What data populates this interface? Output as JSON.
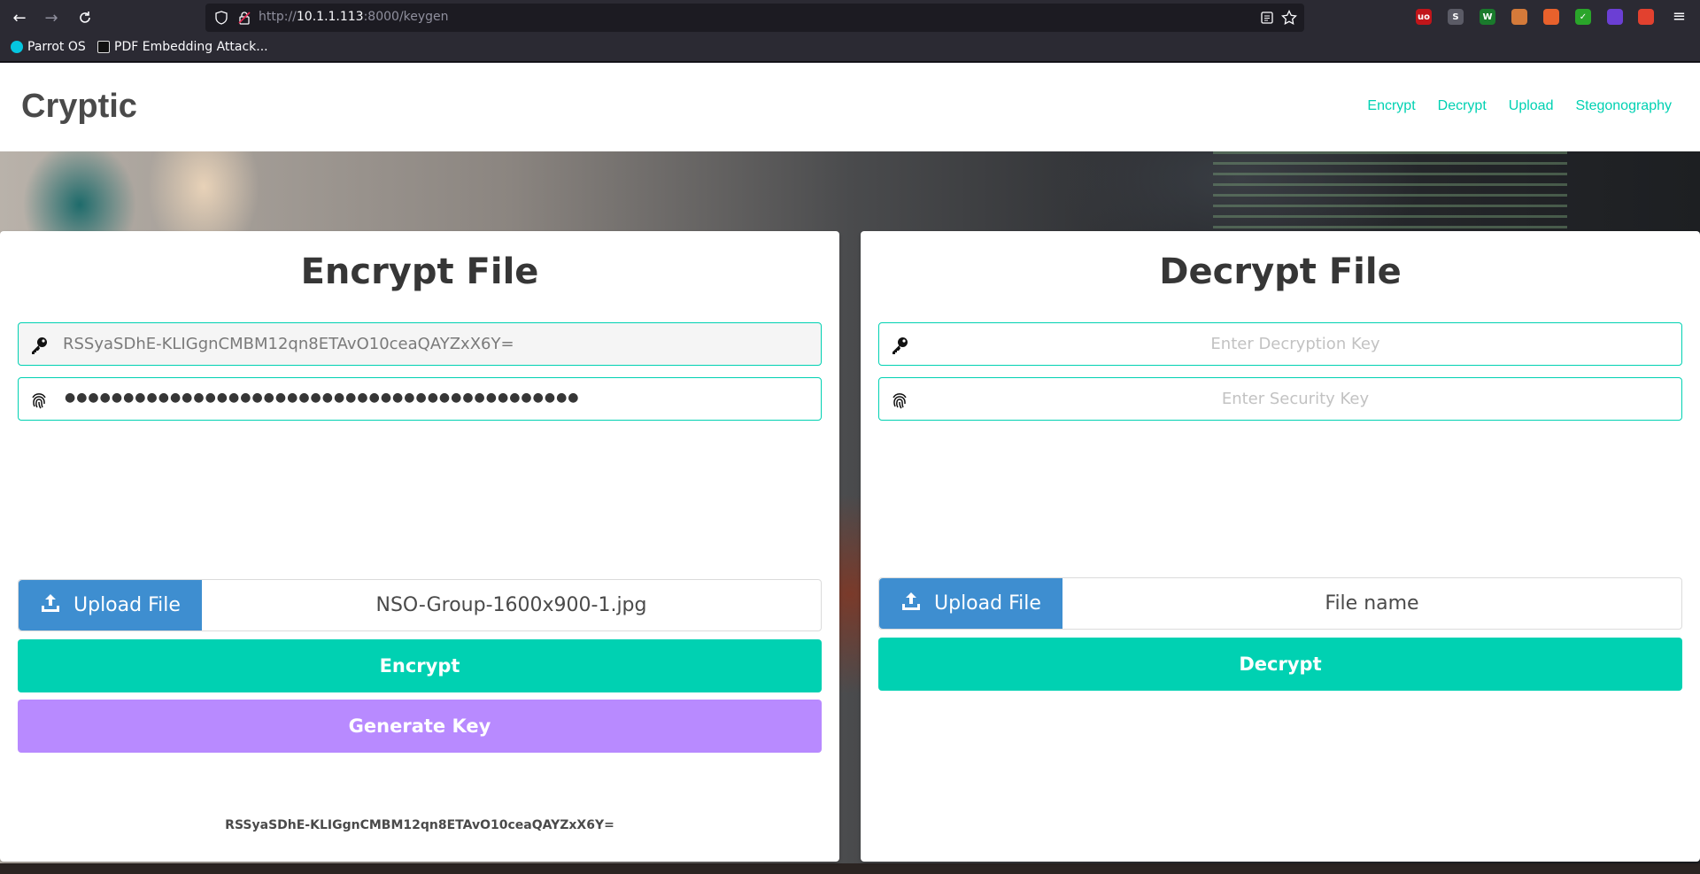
{
  "browser": {
    "url_prefix": "http://",
    "url_host": "10.1.1.113",
    "url_suffix": ":8000/keygen",
    "bookmarks": [
      {
        "label": "Parrot OS"
      },
      {
        "label": "PDF Embedding Attack..."
      }
    ],
    "extensions": [
      {
        "name": "ublock-icon",
        "text": "uo",
        "color": "#c1151a"
      },
      {
        "name": "extension-s-icon",
        "text": "S",
        "color": "#5b5b66"
      },
      {
        "name": "extension-w-icon",
        "text": "W",
        "color": "#1a7a2c"
      },
      {
        "name": "cookie-icon",
        "text": "",
        "color": "#d47a3a"
      },
      {
        "name": "foxyproxy-icon",
        "text": "",
        "color": "#e8612c"
      },
      {
        "name": "check-icon",
        "text": "✓",
        "color": "#2aa52a"
      },
      {
        "name": "extension-purple-icon",
        "text": "",
        "color": "#6b3fd4"
      },
      {
        "name": "extension-hackbar-icon",
        "text": "",
        "color": "#e2412f"
      }
    ]
  },
  "site": {
    "brand": "Cryptic",
    "nav": [
      "Encrypt",
      "Decrypt",
      "Upload",
      "Stegonography"
    ]
  },
  "encrypt": {
    "title": "Encrypt File",
    "key_value": "RSSyaSDhE-KLIGgnCMBM12qn8ETAvO10ceaQAYZxX6Y=",
    "security_mask": "●●●●●●●●●●●●●●●●●●●●●●●●●●●●●●●●●●●●●●●●●●●●",
    "upload_label": "Upload File",
    "file_name": "NSO-Group-1600x900-1.jpg",
    "encrypt_label": "Encrypt",
    "generate_label": "Generate Key",
    "generated_key": "RSSyaSDhE-KLIGgnCMBM12qn8ETAvO10ceaQAYZxX6Y="
  },
  "decrypt": {
    "title": "Decrypt File",
    "key_placeholder": "Enter Decryption Key",
    "security_placeholder": "Enter Security Key",
    "upload_label": "Upload File",
    "file_name": "File name",
    "decrypt_label": "Decrypt"
  },
  "colors": {
    "accent": "#00d1b2",
    "upload": "#3e8ed0",
    "generate": "#b88aff"
  }
}
